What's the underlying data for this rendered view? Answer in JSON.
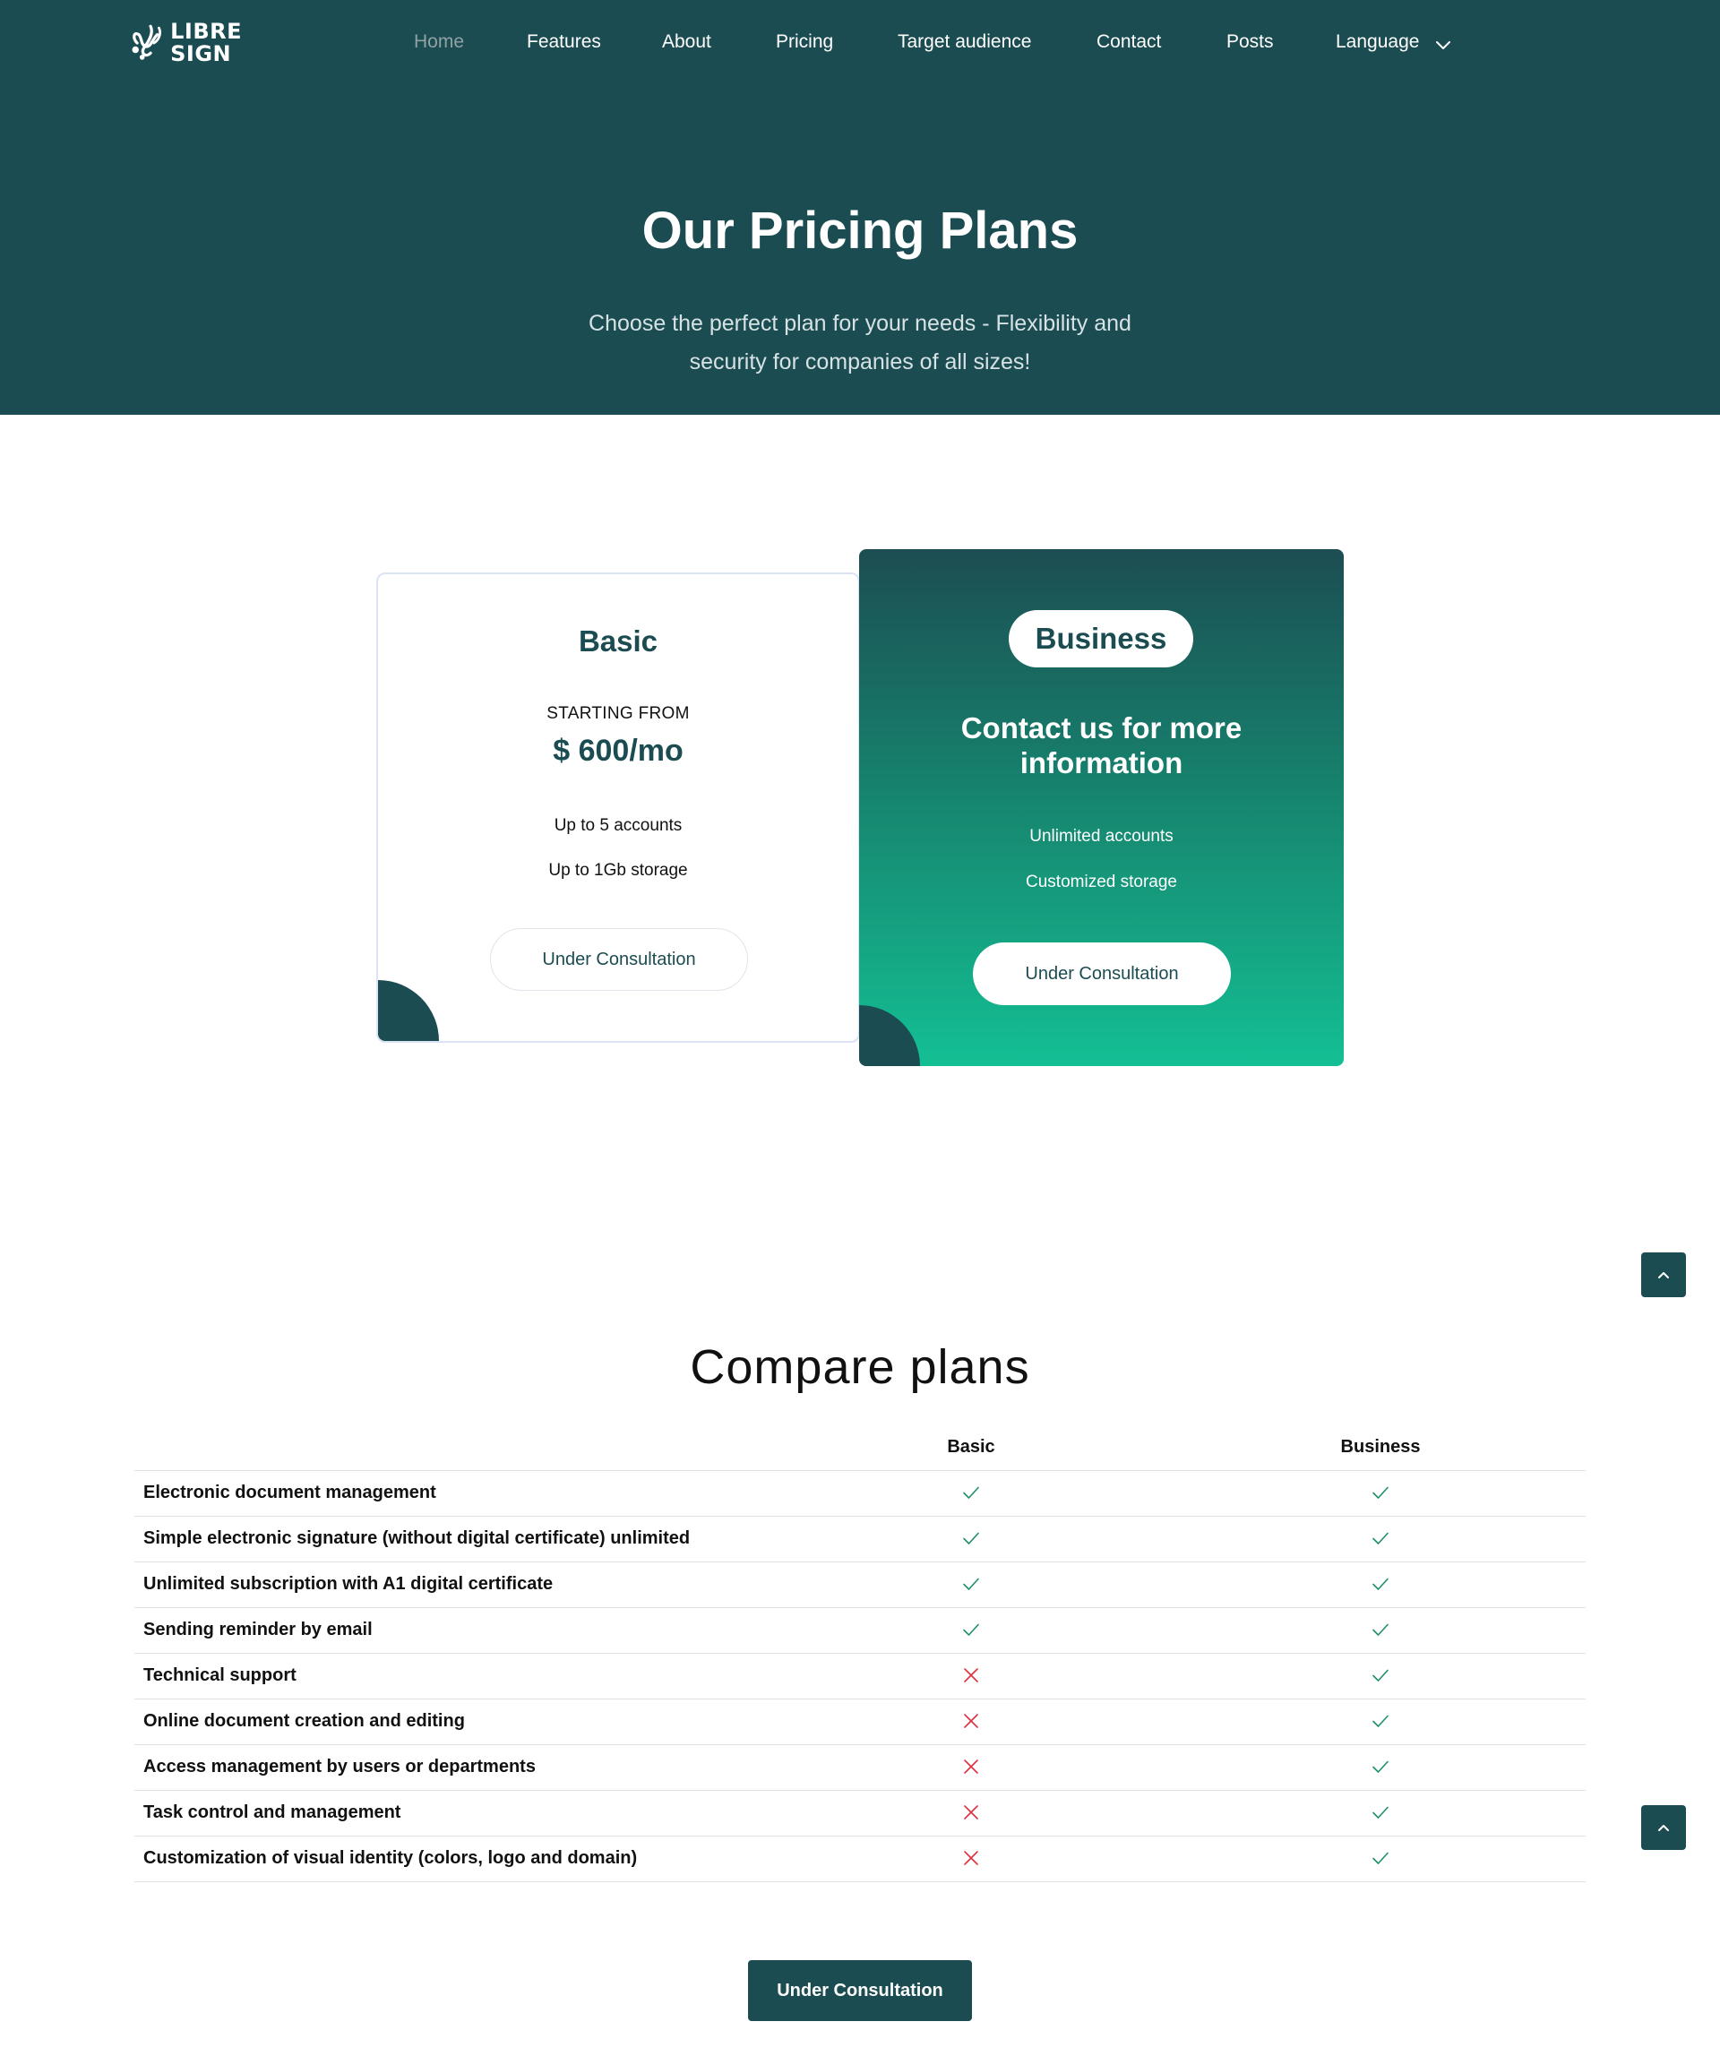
{
  "brand": {
    "logo_text_line1": "LIBRE",
    "logo_text_line2": "SIGN",
    "logo_icon": "signature-leaf-icon"
  },
  "nav": {
    "items": [
      "Home",
      "Features",
      "About",
      "Pricing",
      "Target audience",
      "Contact",
      "Posts",
      "Language"
    ],
    "active": "Home",
    "language_icon": "chevron-down-icon"
  },
  "hero": {
    "title": "Our Pricing Plans",
    "subtitle_line1": "Choose the perfect plan for your needs - Flexibility and",
    "subtitle_line2": "security for companies of all sizes!"
  },
  "plans": {
    "basic": {
      "name": "Basic",
      "starting_label": "STARTING FROM",
      "price": "$ 600/mo",
      "features": [
        "Up to 5 accounts",
        "Up to 1Gb storage"
      ],
      "button": "Under Consultation"
    },
    "business": {
      "name": "Business",
      "heading_line1": "Contact us for more",
      "heading_line2": "information",
      "features": [
        "Unlimited accounts",
        "Customized storage"
      ],
      "button": "Under Consultation"
    }
  },
  "compare": {
    "title": "Compare plans",
    "columns": [
      "Basic",
      "Business"
    ],
    "rows": [
      {
        "label": "Electronic document management",
        "basic": true,
        "business": true
      },
      {
        "label": "Simple electronic signature (without digital certificate) unlimited",
        "basic": true,
        "business": true
      },
      {
        "label": "Unlimited subscription with A1 digital certificate",
        "basic": true,
        "business": true
      },
      {
        "label": "Sending reminder by email",
        "basic": true,
        "business": true
      },
      {
        "label": "Technical support",
        "basic": false,
        "business": true
      },
      {
        "label": "Online document creation and editing",
        "basic": false,
        "business": true
      },
      {
        "label": "Access management by users or departments",
        "basic": false,
        "business": true
      },
      {
        "label": "Task control and management",
        "basic": false,
        "business": true
      },
      {
        "label": "Customization of visual identity (colors, logo and domain)",
        "basic": false,
        "business": true
      }
    ],
    "check_icon": "check-icon",
    "cross_icon": "close-icon",
    "check_color": "#1f8f6a",
    "cross_color": "#e0303f"
  },
  "cta": {
    "button": "Under Consultation"
  },
  "scroll_top_icon": "chevron-up-icon",
  "colors": {
    "primary": "#1b4c51",
    "accent": "#14bf94",
    "text": "#111111"
  }
}
